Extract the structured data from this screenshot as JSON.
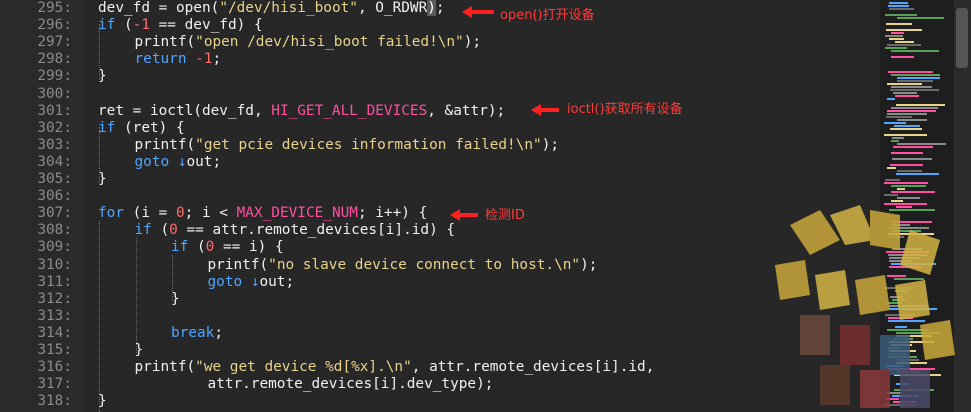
{
  "editor": {
    "lines": [
      {
        "num": "295:",
        "indent": 1,
        "tokens": [
          {
            "t": "dev_fd = ",
            "c": "fn"
          },
          {
            "t": "open",
            "c": "fn"
          },
          {
            "t": "(",
            "c": "fn"
          },
          {
            "t": "\"/dev/hisi_boot\"",
            "c": "str"
          },
          {
            "t": ", O_RDWR",
            "c": "fn"
          },
          {
            "t": ")",
            "c": "hl"
          },
          {
            "t": ";",
            "c": "fn"
          }
        ]
      },
      {
        "num": "296:",
        "indent": 1,
        "tokens": [
          {
            "t": "if",
            "c": "kw"
          },
          {
            "t": " (",
            "c": "fn"
          },
          {
            "t": "-1",
            "c": "num"
          },
          {
            "t": " == dev_fd) {",
            "c": "fn"
          }
        ]
      },
      {
        "num": "297:",
        "indent": 2,
        "tokens": [
          {
            "t": "printf(",
            "c": "fn"
          },
          {
            "t": "\"open /dev/hisi_boot failed!\\n\"",
            "c": "str"
          },
          {
            "t": ");",
            "c": "fn"
          }
        ]
      },
      {
        "num": "298:",
        "indent": 2,
        "tokens": [
          {
            "t": "return",
            "c": "kw"
          },
          {
            "t": " ",
            "c": "fn"
          },
          {
            "t": "-1",
            "c": "num"
          },
          {
            "t": ";",
            "c": "fn"
          }
        ]
      },
      {
        "num": "299:",
        "indent": 1,
        "tokens": [
          {
            "t": "}",
            "c": "fn"
          }
        ]
      },
      {
        "num": "300:",
        "indent": 0,
        "tokens": []
      },
      {
        "num": "301:",
        "indent": 1,
        "tokens": [
          {
            "t": "ret = ioctl(dev_fd, ",
            "c": "fn"
          },
          {
            "t": "HI_GET_ALL_DEVICES",
            "c": "mac"
          },
          {
            "t": ", &attr)",
            "c": "fn"
          },
          {
            "t": ";",
            "c": "fn"
          }
        ]
      },
      {
        "num": "302:",
        "indent": 1,
        "tokens": [
          {
            "t": "if",
            "c": "kw"
          },
          {
            "t": " (ret) {",
            "c": "fn"
          }
        ]
      },
      {
        "num": "303:",
        "indent": 2,
        "tokens": [
          {
            "t": "printf(",
            "c": "fn"
          },
          {
            "t": "\"get pcie devices information failed!\\n\"",
            "c": "str"
          },
          {
            "t": ");",
            "c": "fn"
          }
        ]
      },
      {
        "num": "304:",
        "indent": 2,
        "tokens": [
          {
            "t": "goto",
            "c": "kw"
          },
          {
            "t": " ↓",
            "c": "goto-mark"
          },
          {
            "t": "out;",
            "c": "fn"
          }
        ]
      },
      {
        "num": "305:",
        "indent": 1,
        "tokens": [
          {
            "t": "}",
            "c": "fn"
          }
        ]
      },
      {
        "num": "306:",
        "indent": 0,
        "tokens": []
      },
      {
        "num": "307:",
        "indent": 1,
        "tokens": [
          {
            "t": "for",
            "c": "kw"
          },
          {
            "t": " (i = ",
            "c": "fn"
          },
          {
            "t": "0",
            "c": "num"
          },
          {
            "t": "; i < ",
            "c": "fn"
          },
          {
            "t": "MAX_DEVICE_NUM",
            "c": "mac"
          },
          {
            "t": "; i++) {",
            "c": "fn"
          }
        ]
      },
      {
        "num": "308:",
        "indent": 2,
        "tokens": [
          {
            "t": "if",
            "c": "kw"
          },
          {
            "t": " (",
            "c": "fn"
          },
          {
            "t": "0",
            "c": "num"
          },
          {
            "t": " == attr.remote_devices[i].id) {",
            "c": "fn"
          }
        ]
      },
      {
        "num": "309:",
        "indent": 3,
        "tokens": [
          {
            "t": "if",
            "c": "kw"
          },
          {
            "t": " (",
            "c": "fn"
          },
          {
            "t": "0",
            "c": "num"
          },
          {
            "t": " == i) {",
            "c": "fn"
          }
        ]
      },
      {
        "num": "310:",
        "indent": 4,
        "tokens": [
          {
            "t": "printf(",
            "c": "fn"
          },
          {
            "t": "\"no slave device connect to host.\\n\"",
            "c": "str"
          },
          {
            "t": ");",
            "c": "fn"
          }
        ]
      },
      {
        "num": "311:",
        "indent": 4,
        "tokens": [
          {
            "t": "goto",
            "c": "kw"
          },
          {
            "t": " ↓",
            "c": "goto-mark"
          },
          {
            "t": "out;",
            "c": "fn"
          }
        ]
      },
      {
        "num": "312:",
        "indent": 3,
        "tokens": [
          {
            "t": "}",
            "c": "fn"
          }
        ]
      },
      {
        "num": "313:",
        "indent": 0,
        "tokens": []
      },
      {
        "num": "314:",
        "indent": 3,
        "tokens": [
          {
            "t": "break",
            "c": "kw"
          },
          {
            "t": ";",
            "c": "fn"
          }
        ]
      },
      {
        "num": "315:",
        "indent": 2,
        "tokens": [
          {
            "t": "}",
            "c": "fn"
          }
        ]
      },
      {
        "num": "316:",
        "indent": 2,
        "tokens": [
          {
            "t": "printf(",
            "c": "fn"
          },
          {
            "t": "\"we get device %d[%x].\\n\"",
            "c": "str"
          },
          {
            "t": ", attr.remote_devices[i].id,",
            "c": "fn"
          }
        ]
      },
      {
        "num": "317:",
        "indent": 4,
        "tokens": [
          {
            "t": "attr.remote_devices[i].dev_type);",
            "c": "fn"
          }
        ]
      },
      {
        "num": "318:",
        "indent": 1,
        "tokens": [
          {
            "t": "}",
            "c": "fn"
          }
        ]
      }
    ]
  },
  "annotations": {
    "open_note": "open()打开设备",
    "ioctl_note": "ioctl()获取所有设备",
    "detect_note": "检测ID"
  },
  "colors": {
    "keyword": "#4fa6ff",
    "string": "#e7d38a",
    "number": "#ff6b6b",
    "macro": "#ff4fa0",
    "annotation": "#ff3b3b"
  }
}
